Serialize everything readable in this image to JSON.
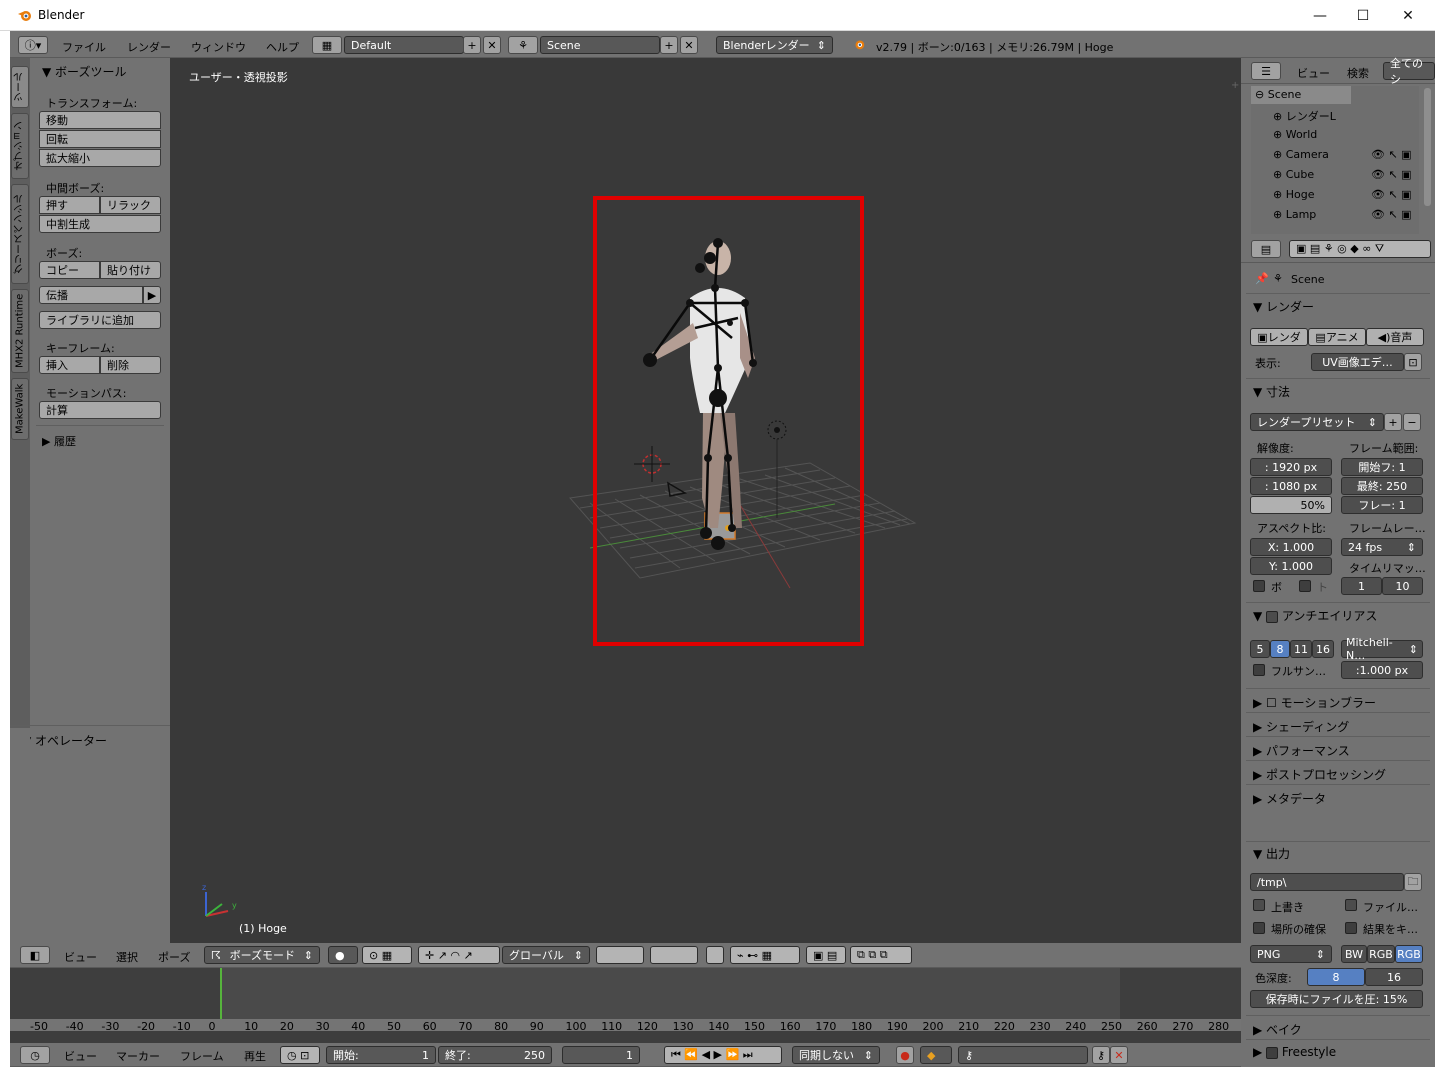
{
  "window": {
    "title": "Blender",
    "minimize": "—",
    "maximize": "☐",
    "close": "✕"
  },
  "topbar": {
    "menus": [
      "ファイル",
      "レンダー",
      "ウィンドウ",
      "ヘルプ"
    ],
    "layout": "Default",
    "scene": "Scene",
    "engine": "Blenderレンダー",
    "stats": "v2.79 | ボーン:0/163 | メモリ:26.79M | Hoge"
  },
  "vtabs": [
    "ツール",
    "オプション",
    "グリースペンシル",
    "MHX2 Runtime",
    "MakeWalk"
  ],
  "toolshelf": {
    "title": "ボーズツール",
    "transform_label": "トランスフォーム:",
    "transform_buttons": [
      "移動",
      "回転",
      "拡大縮小"
    ],
    "inbetween_label": "中間ボーズ:",
    "push": "押す",
    "relax": "リラック",
    "breakdown": "中割生成",
    "pose_label": "ボーズ:",
    "copy": "コピー",
    "paste": "貼り付け",
    "propagate": "伝播",
    "add_library": "ライブラリに追加",
    "keyframe_label": "キーフレーム:",
    "insert": "挿入",
    "delete": "削除",
    "motionpath_label": "モーションパス:",
    "calculate": "計算",
    "history": "履歴",
    "operator": "オペレーター"
  },
  "viewport": {
    "view_label": "ユーザー・透視投影",
    "object_label": "(1) Hoge",
    "axes": {
      "x": "x",
      "y": "y",
      "z": "z"
    },
    "highlight_color": "#e00000"
  },
  "viewport_header": {
    "menus": [
      "ビュー",
      "選択",
      "ポーズ"
    ],
    "mode": "ボーズモード",
    "orientation": "グローバル"
  },
  "outliner": {
    "menus": [
      "ビュー",
      "検索"
    ],
    "filter": "全てのシ",
    "items": [
      {
        "name": "Scene",
        "level": 0
      },
      {
        "name": "レンダーL",
        "level": 1
      },
      {
        "name": "World",
        "level": 1
      },
      {
        "name": "Camera",
        "level": 1
      },
      {
        "name": "Cube",
        "level": 1
      },
      {
        "name": "Hoge",
        "level": 1
      },
      {
        "name": "Lamp",
        "level": 1
      }
    ]
  },
  "properties": {
    "context": "Scene",
    "render_section": "レンダー",
    "render_btn": "レンダ",
    "anim_btn": "アニメ",
    "audio_btn": "音声",
    "display_label": "表示:",
    "display_value": "UV画像エデ…",
    "dimensions": "寸法",
    "preset": "レンダープリセット",
    "resolution_label": "解像度:",
    "frame_range_label": "フレーム範囲:",
    "res_x": ": 1920 px",
    "res_y": ": 1080 px",
    "res_pct": "50%",
    "start": "開始フ:  1",
    "end": "最終: 250",
    "step": "フレー:  1",
    "aspect_label": "アスペクト比:",
    "framerate_label": "フレームレー…",
    "aspect_x": "X:   1.000",
    "aspect_y": "Y:   1.000",
    "fps": "24 fps",
    "time_remap": "タイムリマッ…",
    "border": "ボ",
    "crop": "ト",
    "remap_old": "1",
    "remap_new": "10",
    "aa": "アンチエイリアス",
    "aa_samples": [
      "5",
      "8",
      "11",
      "16"
    ],
    "aa_filter": "Mitchell-N…",
    "full_sample": "フルサン…",
    "filter_size": ":1.000 px",
    "sections": [
      "モーションブラー",
      "シェーディング",
      "パフォーマンス",
      "ポストプロセッシング",
      "メタデータ"
    ],
    "output": "出力",
    "path": "/tmp\\",
    "overwrite": "上書き",
    "file_ext": "ファイル…",
    "placeholders": "場所の確保",
    "cache_result": "結果をキ…",
    "format": "PNG",
    "bw": "BW",
    "rgb": "RGB",
    "rgba": "RGB",
    "depth_label": "色深度:",
    "depth_8": "8",
    "depth_16": "16",
    "compression": "保存時にファイルを圧: 15%",
    "bake": "ベイク",
    "freestyle": "Freestyle"
  },
  "timeline": {
    "ticks": [
      "-50",
      "-40",
      "-30",
      "-20",
      "-10",
      "0",
      "10",
      "20",
      "30",
      "40",
      "50",
      "60",
      "70",
      "80",
      "90",
      "100",
      "110",
      "120",
      "130",
      "140",
      "150",
      "160",
      "170",
      "180",
      "190",
      "200",
      "210",
      "220",
      "230",
      "240",
      "250",
      "260",
      "270",
      "280"
    ],
    "menus": [
      "ビュー",
      "マーカー",
      "フレーム",
      "再生"
    ],
    "start_label": "開始:",
    "start": "1",
    "end_label": "終了:",
    "end": "250",
    "current": "1",
    "sync": "同期しない"
  }
}
